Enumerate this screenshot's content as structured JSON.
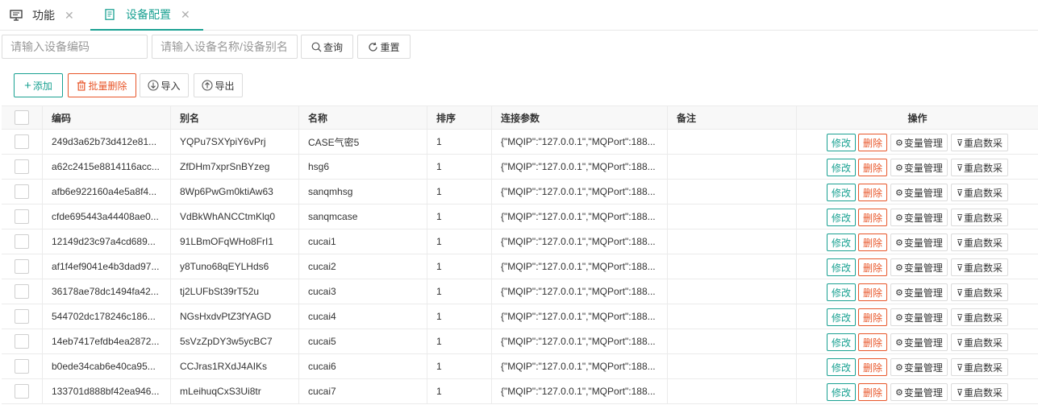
{
  "tabs": [
    {
      "label": "功能",
      "icon": "monitor-icon"
    },
    {
      "label": "设备配置",
      "icon": "document-icon",
      "active": true
    }
  ],
  "search": {
    "code_placeholder": "请输入设备编码",
    "name_placeholder": "请输入设备名称/设备别名",
    "query_label": "查询",
    "reset_label": "重置"
  },
  "toolbar": {
    "add_label": "添加",
    "batch_delete_label": "批量删除",
    "import_label": "导入",
    "export_label": "导出"
  },
  "colors": {
    "accent": "#1aa192",
    "danger": "#e8562a"
  },
  "table": {
    "headers": {
      "code": "编码",
      "alias": "别名",
      "name": "名称",
      "order": "排序",
      "params": "连接参数",
      "remark": "备注",
      "ops": "操作"
    },
    "row_actions": {
      "edit": "修改",
      "delete": "删除",
      "variables": "变量管理",
      "restart": "重启数采"
    },
    "rows": [
      {
        "code": "249d3a62b73d412e81...",
        "alias": "YQPu7SXYpiY6vPrj",
        "name": "CASE气密5",
        "order": "1",
        "params": "{\"MQIP\":\"127.0.0.1\",\"MQPort\":188...",
        "remark": ""
      },
      {
        "code": "a62c2415e8814116acc...",
        "alias": "ZfDHm7xprSnBYzeg",
        "name": "hsg6",
        "order": "1",
        "params": "{\"MQIP\":\"127.0.0.1\",\"MQPort\":188...",
        "remark": ""
      },
      {
        "code": "afb6e922160a4e5a8f4...",
        "alias": "8Wp6PwGm0ktiAw63",
        "name": "sanqmhsg",
        "order": "1",
        "params": "{\"MQIP\":\"127.0.0.1\",\"MQPort\":188...",
        "remark": ""
      },
      {
        "code": "cfde695443a44408ae0...",
        "alias": "VdBkWhANCCtmKlq0",
        "name": "sanqmcase",
        "order": "1",
        "params": "{\"MQIP\":\"127.0.0.1\",\"MQPort\":188...",
        "remark": ""
      },
      {
        "code": "12149d23c97a4cd689...",
        "alias": "91LBmOFqWHo8FrI1",
        "name": "cucai1",
        "order": "1",
        "params": "{\"MQIP\":\"127.0.0.1\",\"MQPort\":188...",
        "remark": ""
      },
      {
        "code": "af1f4ef9041e4b3dad97...",
        "alias": "y8Tuno68qEYLHds6",
        "name": "cucai2",
        "order": "1",
        "params": "{\"MQIP\":\"127.0.0.1\",\"MQPort\":188...",
        "remark": ""
      },
      {
        "code": "36178ae78dc1494fa42...",
        "alias": "tj2LUFbSt39rT52u",
        "name": "cucai3",
        "order": "1",
        "params": "{\"MQIP\":\"127.0.0.1\",\"MQPort\":188...",
        "remark": ""
      },
      {
        "code": "544702dc178246c186...",
        "alias": "NGsHxdvPtZ3fYAGD",
        "name": "cucai4",
        "order": "1",
        "params": "{\"MQIP\":\"127.0.0.1\",\"MQPort\":188...",
        "remark": ""
      },
      {
        "code": "14eb7417efdb4ea2872...",
        "alias": "5sVzZpDY3w5ycBC7",
        "name": "cucai5",
        "order": "1",
        "params": "{\"MQIP\":\"127.0.0.1\",\"MQPort\":188...",
        "remark": ""
      },
      {
        "code": "b0ede34cab6e40ca95...",
        "alias": "CCJras1RXdJ4AIKs",
        "name": "cucai6",
        "order": "1",
        "params": "{\"MQIP\":\"127.0.0.1\",\"MQPort\":188...",
        "remark": ""
      },
      {
        "code": "133701d888bf42ea946...",
        "alias": "mLeihuqCxS3Ui8tr",
        "name": "cucai7",
        "order": "1",
        "params": "{\"MQIP\":\"127.0.0.1\",\"MQPort\":188...",
        "remark": ""
      }
    ]
  }
}
